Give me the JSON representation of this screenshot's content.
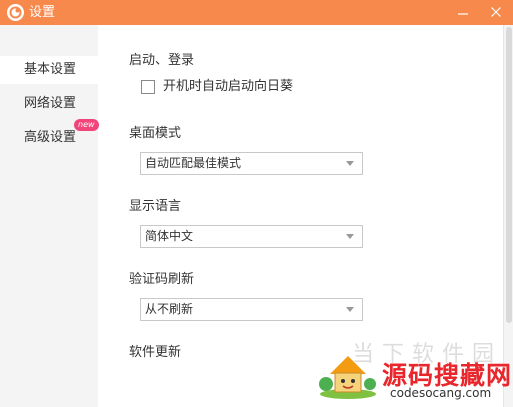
{
  "window": {
    "title": "设置",
    "accent_color": "#f7894c",
    "controls": {
      "minimize_icon": "minimize-icon",
      "close_icon": "close-icon"
    }
  },
  "sidebar": {
    "items": [
      {
        "label": "基本设置",
        "active": true
      },
      {
        "label": "网络设置",
        "active": false
      },
      {
        "label": "高级设置",
        "active": false,
        "badge": "new"
      }
    ]
  },
  "sections": {
    "startup": {
      "title": "启动、登录",
      "checkbox_label": "开机时自动启动向日葵",
      "checked": false
    },
    "desktop_mode": {
      "title": "桌面模式",
      "selected": "自动匹配最佳模式"
    },
    "language": {
      "title": "显示语言",
      "selected": "简体中文"
    },
    "captcha_refresh": {
      "title": "验证码刷新",
      "selected": "从不刷新"
    },
    "software_update": {
      "title": "软件更新"
    }
  },
  "watermark": {
    "faint_text": "当下软件园",
    "main_text": "源码搜藏网",
    "url": "codesocang.com"
  }
}
